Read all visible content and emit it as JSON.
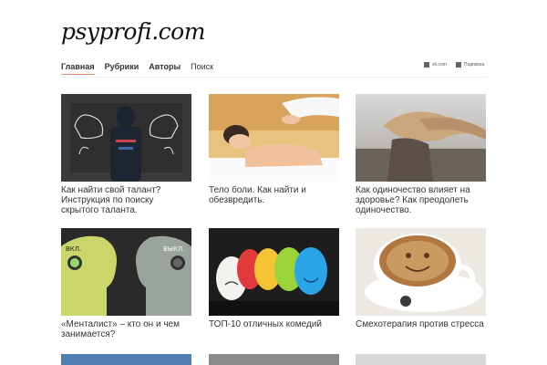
{
  "site": {
    "logo": "psyprofi.com"
  },
  "nav": {
    "items": [
      {
        "label": "Главная",
        "active": true,
        "bold": true
      },
      {
        "label": "Рубрики",
        "bold": true
      },
      {
        "label": "Авторы",
        "bold": true
      },
      {
        "label": "Поиск",
        "bold": false
      }
    ],
    "right": [
      {
        "label": "vk.com",
        "icon": "vk-icon"
      },
      {
        "label": "Подписка",
        "icon": "rss-icon"
      }
    ]
  },
  "articles": [
    {
      "title": "Как найти свой талант? Инструкция по поиску скрытого таланта."
    },
    {
      "title": "Тело боли. Как найти и обезвредить."
    },
    {
      "title": "Как одиночество влияет на здоровье? Как преодолеть одиночество."
    },
    {
      "title": "«Менталист» – кто он и чем занимается?",
      "image_labels": {
        "on": "ВКЛ.",
        "off": "ВЫКЛ."
      }
    },
    {
      "title": "ТОП-10 отличных комедий"
    },
    {
      "title": "Смехотерапия против стресса"
    }
  ],
  "colors": {
    "accent": "#e08a6a"
  }
}
